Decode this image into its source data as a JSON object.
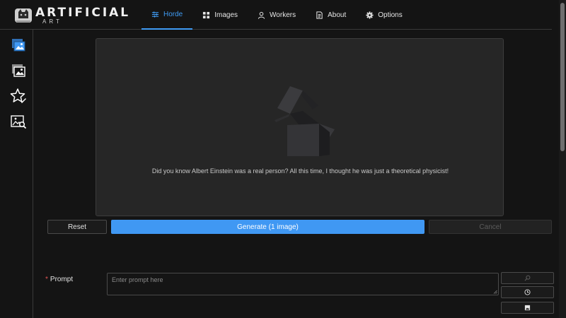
{
  "app": {
    "logo_text": "ARTIFICIAL",
    "logo_subtext": "ART"
  },
  "nav": {
    "items": [
      {
        "label": "Horde",
        "icon": "sliders-icon",
        "active": true
      },
      {
        "label": "Images",
        "icon": "grid-icon",
        "active": false
      },
      {
        "label": "Workers",
        "icon": "user-icon",
        "active": false
      },
      {
        "label": "About",
        "icon": "document-icon",
        "active": false
      },
      {
        "label": "Options",
        "icon": "gear-icon",
        "active": false
      }
    ]
  },
  "sidebar": {
    "items": [
      {
        "icon": "generate-image-icon",
        "active": true
      },
      {
        "icon": "gallery-icon",
        "active": false
      },
      {
        "icon": "star-edit-icon",
        "active": false
      },
      {
        "icon": "image-search-icon",
        "active": false
      }
    ]
  },
  "preview": {
    "tip": "Did you know Albert Einstein was a real person? All this time, I thought he was just a theoretical physicist!"
  },
  "actions": {
    "reset_label": "Reset",
    "generate_label": "Generate (1 image)",
    "cancel_label": "Cancel"
  },
  "prompt": {
    "label": "Prompt",
    "required_mark": "*",
    "placeholder": "Enter prompt here",
    "value": ""
  },
  "colors": {
    "accent": "#4098f3",
    "background": "#141414",
    "panel": "#262626",
    "required": "#e05555"
  }
}
